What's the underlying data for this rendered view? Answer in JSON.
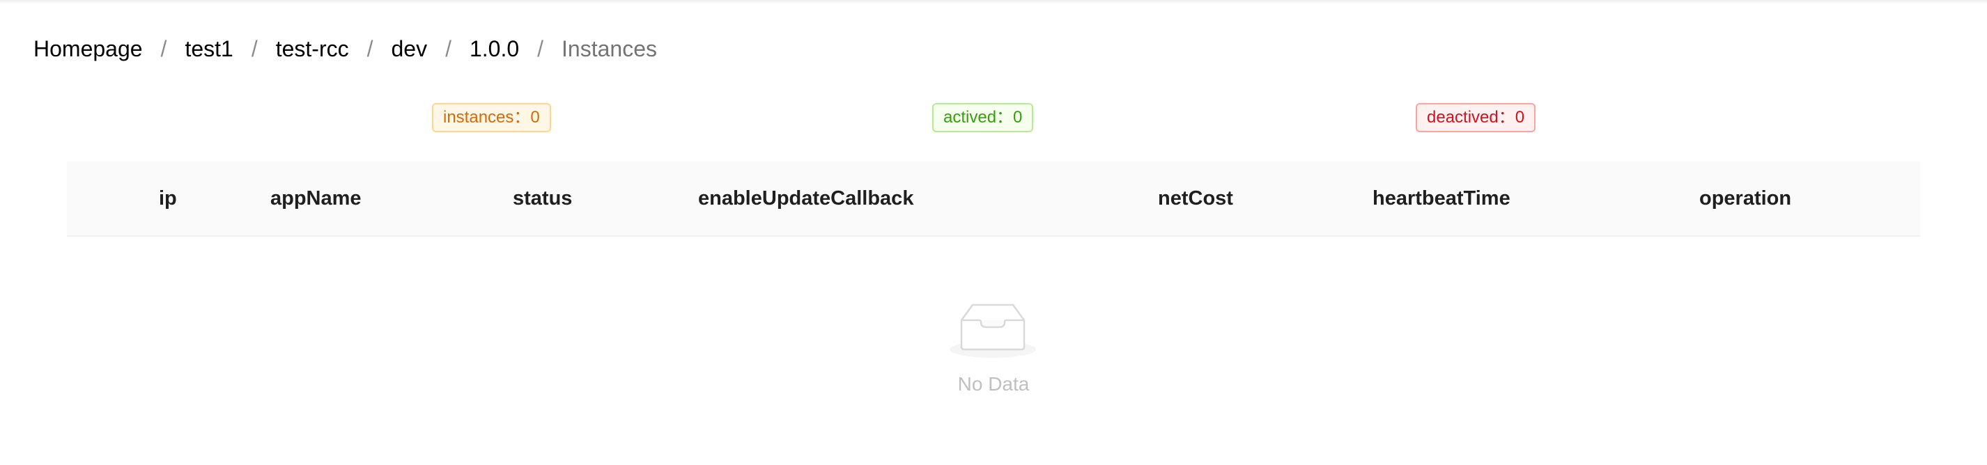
{
  "breadcrumb": {
    "items": [
      {
        "label": "Homepage"
      },
      {
        "label": "test1"
      },
      {
        "label": "test-rcc"
      },
      {
        "label": "dev"
      },
      {
        "label": "1.0.0"
      },
      {
        "label": "Instances"
      }
    ],
    "separator": "/"
  },
  "stats": {
    "instances": "instances：0",
    "actived": "actived：0",
    "deactived": "deactived：0"
  },
  "table": {
    "columns": [
      "ip",
      "appName",
      "status",
      "enableUpdateCallback",
      "netCost",
      "heartbeatTime",
      "operation"
    ],
    "rows": [],
    "empty_text": "No Data"
  },
  "colors": {
    "tag_orange": "#d46b08",
    "tag_green": "#389e0d",
    "tag_red": "#cf1322",
    "header_bg": "#fafafa"
  },
  "icons": {
    "empty": "empty-inbox-icon"
  }
}
